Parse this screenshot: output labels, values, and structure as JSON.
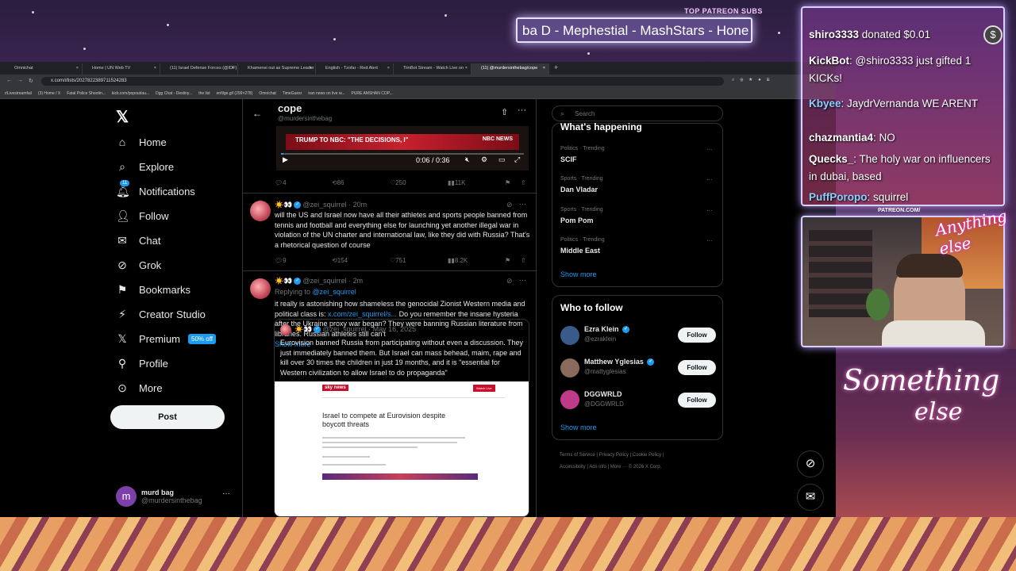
{
  "stream": {
    "top_label": "TOP PATREON SUBS",
    "ticker": "ba D - Mephestial - MashStars - Hone",
    "patreon_tag": "PATREON.COM/",
    "cam_signature": "Anything else",
    "brand_word1": "Something",
    "brand_word2": "else",
    "chat": [
      {
        "user": "shiro3333",
        "text": " donated $0.01"
      },
      {
        "user": "KickBot",
        "text": ": @shiro3333 just gifted 1 KICKs!"
      },
      {
        "user": "Kbyee",
        "text": ": JaydrVernanda WE ARENT"
      },
      {
        "user": "chazmantia4",
        "text": ": NO"
      },
      {
        "user": "Quecks_",
        "text": ": The holy war on influencers in dubai, based"
      },
      {
        "user": "PuffPoropo",
        "text": ": squirrel"
      }
    ]
  },
  "browser": {
    "tabs": [
      {
        "label": "Omnichat"
      },
      {
        "label": "Home | UN Web TV"
      },
      {
        "label": "(11) Israel Defense Forces (@IDF)"
      },
      {
        "label": "Khamenei out as Supreme Leader"
      },
      {
        "label": "English - Tzofar - Red Alert"
      },
      {
        "label": "TimBot Stream - Watch Live on"
      },
      {
        "label": "(11) @murdersinthebag/cope"
      }
    ],
    "url": "x.com/i/lists/2027822389711524283",
    "bookmarks": [
      "r/Livestreamfail",
      "(3) Home / X",
      "Fatal Police Shootin...",
      "kick.com/popout/au...",
      "Dgg Chat - Destiny...",
      "the list",
      "enfilge.gif (299×278)",
      "Omnichat",
      "TimeGuesr",
      "iran news on live w...",
      "PURE AMSHAN COP..."
    ]
  },
  "nav": {
    "items": [
      {
        "label": "Home"
      },
      {
        "label": "Explore"
      },
      {
        "label": "Notifications",
        "badge": "11"
      },
      {
        "label": "Follow"
      },
      {
        "label": "Chat"
      },
      {
        "label": "Grok"
      },
      {
        "label": "Bookmarks"
      },
      {
        "label": "Creator Studio"
      },
      {
        "label": "Premium",
        "badge": "50% off"
      },
      {
        "label": "Profile"
      },
      {
        "label": "More"
      }
    ],
    "post_label": "Post",
    "user_initial": "m",
    "user_name": "murd bag",
    "user_handle": "@murdersinthebag"
  },
  "header": {
    "title": "cope",
    "handle": "@murdersinthebag"
  },
  "video": {
    "banner_left": "TRUMP TO NBC: \"THE DECISIONS, I\"",
    "banner_right": "NBC NEWS",
    "time": "0:06 / 0:36",
    "progress": 0.01,
    "replies": "4",
    "reposts": "86",
    "likes": "250",
    "views": "11K"
  },
  "posts": [
    {
      "author": "☀️👀",
      "handle": "@zei_squirrel",
      "time": "· 20m",
      "text": "will the US and Israel now have all their athletes and sports people banned from tennis and football and everything else for launching yet another illegal war in violation of the UN charter and international law, like they did with Russia? That's a rhetorical question of course",
      "replies": "9",
      "reposts": "154",
      "likes": "751",
      "views": "8.2K"
    },
    {
      "author": "☀️👀",
      "handle": "@zei_squirrel",
      "time": "· 2m",
      "replying_to_label": "Replying to",
      "replying_to": "@zei_squirrel",
      "text_a": "it really is astonishing how shameless the genocidal Zionist Western media and political class is: ",
      "link": "x.com/zei_squirrel/s...",
      "text_b": " Do you remember the insane hysteria after the Ukraine proxy war began? They were banning Russian literature from libraries. Russian athletes still can't",
      "show_more": "Show more",
      "quote": {
        "author": "☀️👀",
        "handle": "@zei_squirrel",
        "time": "· May 16, 2025",
        "text": "Eurovision banned Russia from participating without even a discussion. They just immediately banned them. But Israel can mass behead, maim, rape and kill over 30 times the children in just 19 months, and it is \"essential for Western civilization to allow Israel to do propaganda\"",
        "image_logo": "sky news",
        "image_subscribe": "Watch Live",
        "image_title": "Israel to compete at Eurovision despite boycott threats"
      }
    }
  ],
  "right": {
    "search_placeholder": "Search",
    "happening_title": "What's happening",
    "trends": [
      {
        "category": "Politics · Trending",
        "name": "SCIF"
      },
      {
        "category": "Sports · Trending",
        "name": "Dan Vladar"
      },
      {
        "category": "Sports · Trending",
        "name": "Pom Pom"
      },
      {
        "category": "Politics · Trending",
        "name": "Middle East"
      }
    ],
    "show_more": "Show more",
    "wtf_title": "Who to follow",
    "wtf": [
      {
        "name": "Ezra Klein",
        "handle": "@ezraklein",
        "color": "#3a5a8a"
      },
      {
        "name": "Matthew Yglesias",
        "handle": "@mattyglesias",
        "color": "#8a6a5a"
      },
      {
        "name": "DGGWRLD",
        "handle": "@DGGWRLD",
        "color": "#c03a8a"
      }
    ],
    "follow_label": "Follow",
    "footer_1": "Terms of Service  |  Privacy Policy  |  Cookie Policy  |",
    "footer_2": "Accessibility  |  Ads info  |  More ···  © 2026 X Corp."
  }
}
